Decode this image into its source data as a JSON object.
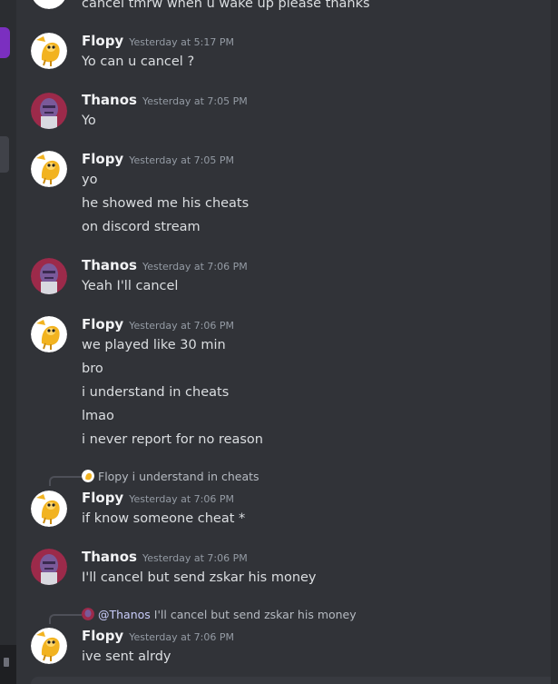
{
  "messages": {
    "top_cutoff": "cancel tmrw when u wake up please thanks",
    "group1": {
      "author": "Flopy",
      "timestamp": "Yesterday at 5:17 PM",
      "lines": [
        "Yo can u cancel ?"
      ]
    },
    "group2": {
      "author": "Thanos",
      "timestamp": "Yesterday at 7:05 PM",
      "lines": [
        "Yo"
      ]
    },
    "group3": {
      "author": "Flopy",
      "timestamp": "Yesterday at 7:05 PM",
      "lines": [
        "yo",
        "he showed me his cheats",
        "on discord stream"
      ]
    },
    "group4": {
      "author": "Thanos",
      "timestamp": "Yesterday at 7:06 PM",
      "lines": [
        "Yeah I'll cancel"
      ]
    },
    "group5": {
      "author": "Flopy",
      "timestamp": "Yesterday at 7:06 PM",
      "lines": [
        "we played like 30 min",
        "bro",
        "i understand in cheats",
        "lmao",
        "i never report for no reason"
      ]
    },
    "group6": {
      "reply_name": "Flopy",
      "reply_text": "i understand in cheats",
      "author": "Flopy",
      "timestamp": "Yesterday at 7:06 PM",
      "lines": [
        "if know someone cheat *"
      ]
    },
    "group7": {
      "author": "Thanos",
      "timestamp": "Yesterday at 7:06 PM",
      "lines": [
        "I'll cancel but send zskar his money"
      ]
    },
    "group8": {
      "reply_name": "@Thanos",
      "reply_text": "I'll cancel but send zskar his money",
      "author": "Flopy",
      "timestamp": "Yesterday at 7:06 PM",
      "lines": [
        "ive sent alrdy"
      ]
    }
  },
  "icons": {
    "flopy_avatar": "jake-the-dog-avatar",
    "thanos_avatar": "thanos-avatar"
  },
  "colors": {
    "background": "#313338",
    "text": "#dbdee1",
    "timestamp": "#949ba4",
    "author": "#f2f3f5",
    "server_accent": "#7b2fc0"
  }
}
